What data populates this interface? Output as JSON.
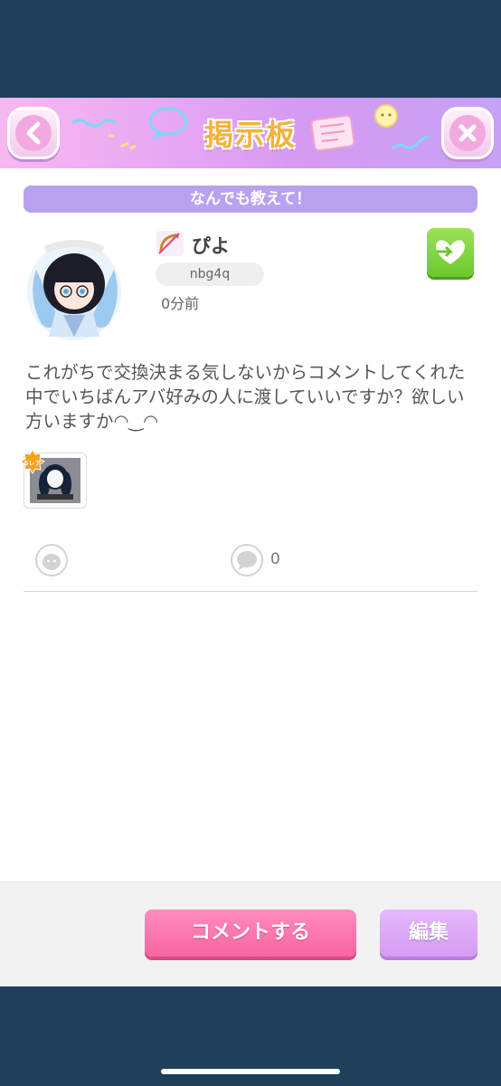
{
  "header": {
    "title": "掲示板",
    "back_icon": "chevron-left-icon",
    "close_icon": "close-icon",
    "accent_color": "#f5b13a"
  },
  "post": {
    "category": "なんでも教えて！",
    "username": "ぴよ",
    "user_id": "nbg4q",
    "time": "0分前",
    "body": "これがちで交換決まる気しないからコメントしてくれた中でいちばんアバ好みの人に渡していいですか？欲しい方いますか◠‿◠",
    "item_badge": "Sレア",
    "comment_count": "0"
  },
  "footer": {
    "comment_label": "コメントする",
    "edit_label": "編集"
  },
  "colors": {
    "category_bg": "#b8a2f0",
    "trade_green": "#6cc92b",
    "comment_pink": "#f9649f",
    "edit_purple": "#d49cf3"
  }
}
